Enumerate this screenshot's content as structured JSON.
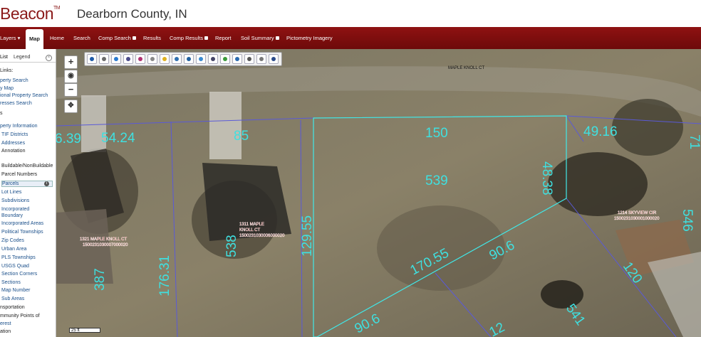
{
  "header": {
    "logo": "Beacon",
    "logo_mark": "TM",
    "county": "Dearborn County, IN"
  },
  "nav": [
    {
      "label": "Layers ▾",
      "active": false,
      "lock": false
    },
    {
      "label": "Map",
      "active": true,
      "lock": false
    },
    {
      "label": "Home",
      "active": false,
      "lock": false
    },
    {
      "label": "Search",
      "active": false,
      "lock": false
    },
    {
      "label": "Comp Search",
      "active": false,
      "lock": true
    },
    {
      "label": "Results",
      "active": false,
      "lock": false
    },
    {
      "label": "Comp Results",
      "active": false,
      "lock": true
    },
    {
      "label": "Report",
      "active": false,
      "lock": false
    },
    {
      "label": "Soil Summary",
      "active": false,
      "lock": true
    },
    {
      "label": "Pictometry Imagery",
      "active": false,
      "lock": false
    }
  ],
  "sidebar": {
    "tabs": [
      "List",
      "Legend"
    ],
    "lines": [
      {
        "text": "Links:",
        "style": "dark"
      },
      {
        "text": "perty Search",
        "style": "link"
      },
      {
        "text": "y Map",
        "style": "link"
      },
      {
        "text": "ional Property Search",
        "style": "link"
      },
      {
        "text": "resses Search",
        "style": "link"
      },
      {
        "text": "s",
        "style": "dark"
      },
      {
        "text": "perty Information",
        "style": "link"
      },
      {
        "text": "TIF Districts",
        "style": "link"
      },
      {
        "text": "Addresses",
        "style": "link"
      },
      {
        "text": "Annotation",
        "style": "dark"
      },
      {
        "text": "Buildable/NonBuildable",
        "style": "dark"
      },
      {
        "text": "Parcel Numbers",
        "style": "dark"
      },
      {
        "text": "Parcels",
        "style": "link",
        "selected": true
      },
      {
        "text": "Lot Lines",
        "style": "link"
      },
      {
        "text": "Subdivisions",
        "style": "link"
      },
      {
        "text": "Incorporated",
        "style": "link"
      },
      {
        "text": "Boundary",
        "style": "link"
      },
      {
        "text": "Incorporated Areas",
        "style": "link"
      },
      {
        "text": "Political Townships",
        "style": "link"
      },
      {
        "text": "Zip Codes",
        "style": "link"
      },
      {
        "text": "Urban Area",
        "style": "link"
      },
      {
        "text": "PLS Townships",
        "style": "link"
      },
      {
        "text": "USGS Quad",
        "style": "link"
      },
      {
        "text": "Section Corners",
        "style": "link"
      },
      {
        "text": "Sections",
        "style": "link"
      },
      {
        "text": "Map Number",
        "style": "link"
      },
      {
        "text": "Sub Areas",
        "style": "link"
      },
      {
        "text": "nsportation",
        "style": "dark"
      },
      {
        "text": "mmunity Points of",
        "style": "dark"
      },
      {
        "text": "erest",
        "style": "link"
      },
      {
        "text": "ation",
        "style": "dark"
      }
    ]
  },
  "map": {
    "zoom_in": "+",
    "zoom_out": "−",
    "scale": "25 ft",
    "road_label": "MAPLE KNOLL CT",
    "dimensions": [
      "6.39",
      "54.24",
      "85",
      "150",
      "49.16",
      "48.38",
      "539",
      "129.55",
      "538",
      "176.31",
      "170.55",
      "90.6",
      "120",
      "90.6",
      "541",
      "387",
      "546",
      "71",
      "12"
    ],
    "parcels": [
      {
        "line1": "1321 MAPLE KNOLL CT",
        "line2": "1500231030007000020"
      },
      {
        "line1": "1311 MAPLE",
        "line2": "KNOLL CT",
        "line3": "1500231030006000020"
      },
      {
        "line1": "1214 SKYVIEW CIR",
        "line2": "1500231030001000020"
      }
    ]
  },
  "colors": {
    "nav": "#7d0e0e",
    "parcel_line": "#5a5ad8",
    "dimension": "#3fe0e0",
    "selected_parcel": "#40e8e8",
    "parcel_label": "#ff3a3a"
  }
}
